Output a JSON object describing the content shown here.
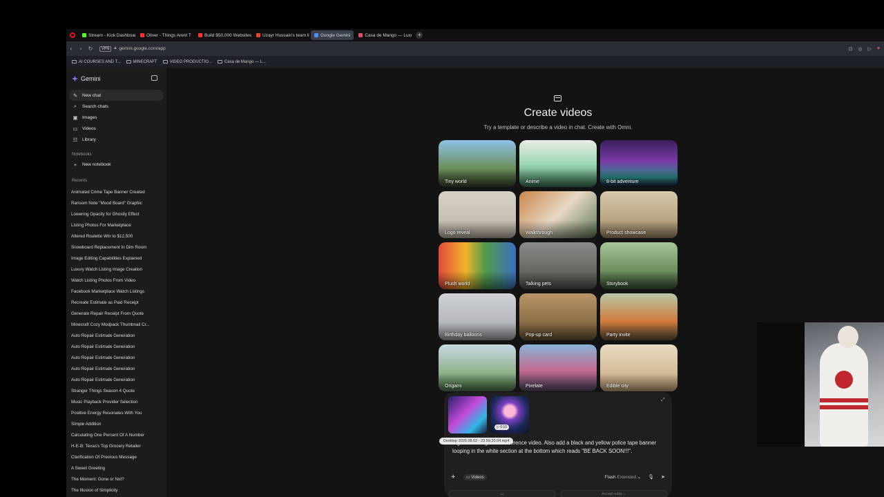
{
  "browser": {
    "tabs": [
      {
        "label": "Stream - Kick Dashboard",
        "color": "#53fc18"
      },
      {
        "label": "Oliver - Things Arent T",
        "color": "#ff2d2d"
      },
      {
        "label": "Build $50,000 Websites U",
        "color": "#ff2d2d"
      },
      {
        "label": "Uzayr Hussain's team libr",
        "color": "#ea4335"
      },
      {
        "label": "Google Gemini",
        "color": "#4c8df6",
        "active": true
      },
      {
        "label": "Casa de Mango — Luxury",
        "color": "#e34d6a"
      }
    ],
    "new_tab": "+",
    "vpn": "VPN",
    "url": "gemini.google.com/app",
    "bookmarks": [
      "AI COURSES AND T...",
      "MINECRAFT",
      "VIDEO PRODUCTIO...",
      "Casa de Mango — L..."
    ]
  },
  "sidebar": {
    "brand": "Gemini",
    "nav": [
      {
        "label": "New chat",
        "icon": "new-chat-icon",
        "glyph": "✎"
      },
      {
        "label": "Search chats",
        "icon": "search-icon",
        "glyph": "⌕"
      },
      {
        "label": "Images",
        "icon": "image-icon",
        "glyph": "▣"
      },
      {
        "label": "Videos",
        "icon": "video-icon",
        "glyph": "▭"
      },
      {
        "label": "Library",
        "icon": "library-icon",
        "glyph": "☷"
      }
    ],
    "notebooks_title": "Notebooks",
    "new_notebook": "New notebook",
    "recents_title": "Recents",
    "recents": [
      "Animated Crime Tape Banner Created",
      "Ransom Note \"Mood Board\" Graphic",
      "Lowering Opacity for Ghostly Effect",
      "Listing Photos For Marketplace",
      "Altered Roulette Win to $12,500",
      "Snowboard Replacement In Dim Room",
      "Image Editing Capabilities Explained",
      "Luxury Watch Listing Image Creation",
      "Watch Listing Photos From Video",
      "Facebook Marketplace Watch Listings",
      "Recreate Estimate as Paid Receipt",
      "Generate Repair Receipt From Quote",
      "Minecraft Cozy Modpack Thumbnail Cr...",
      "Auto Repair Estimate Generation",
      "Auto Repair Estimate Generation",
      "Auto Repair Estimate Generation",
      "Auto Repair Estimate Generation",
      "Auto Repair Estimate Generation",
      "Stranger Things Season 4 Quote",
      "Music Playback Provider Selection",
      "Positive Energy Resonates With You",
      "Simple Addition",
      "Calculating One Percent Of A Number",
      "H-E-B: Texas's Top Grocery Retailer",
      "Clarification Of Previous Message",
      "A Sweet Greeting",
      "The Moment: Gone or Not?",
      "The Illusion of Simplicity"
    ]
  },
  "main": {
    "heading": "Create videos",
    "subheading": "Try a template or describe a video in chat. Create with Omni.",
    "templates": [
      {
        "label": "Tiny world",
        "bg": "linear-gradient(180deg,#8fc0e8,#6b8f5a 60%,#3c4a2c)"
      },
      {
        "label": "Anime",
        "bg": "linear-gradient(180deg,#e9ede7,#9fd8b5 50%,#3b7a56)"
      },
      {
        "label": "8-bit adventure",
        "bg": "linear-gradient(180deg,#3a1f5c,#7a3aa6 45%,#2b8f8a 80%,#1c1c3c)"
      },
      {
        "label": "Logo reveal",
        "bg": "linear-gradient(180deg,#d8d1c6,#bfb6a8)"
      },
      {
        "label": "Walkthrough",
        "bg": "linear-gradient(135deg,#c9864a,#e8d8c4 50%,#5f7a5a)"
      },
      {
        "label": "Product showcase",
        "bg": "linear-gradient(180deg,#d7c9ac,#a58f6a)"
      },
      {
        "label": "Plush world",
        "bg": "linear-gradient(90deg,#e24a3a,#f0b42b 35%,#4f9c48 60%,#3b6fc2)"
      },
      {
        "label": "Talking pets",
        "bg": "linear-gradient(180deg,#8a8a88,#55524d)"
      },
      {
        "label": "Storybook",
        "bg": "linear-gradient(180deg,#a9c49a,#6e8f5f 60%,#3f5a3a)"
      },
      {
        "label": "Birthday balloons",
        "bg": "linear-gradient(180deg,#cfd2d6,#a6a9ae)"
      },
      {
        "label": "Pop-up card",
        "bg": "linear-gradient(180deg,#b89566,#6f5634)"
      },
      {
        "label": "Party invite",
        "bg": "linear-gradient(180deg,#b9c9a9,#d07a3a 60%,#6e5a3e)"
      },
      {
        "label": "Origami",
        "bg": "linear-gradient(180deg,#c9d9e4,#8fb38a 60%,#4f7a4c)"
      },
      {
        "label": "Pixelate",
        "bg": "linear-gradient(180deg,#8ab4d8,#c06a8e 55%,#5a4a6a)"
      },
      {
        "label": "Edible city",
        "bg": "linear-gradient(180deg,#e8dcc4,#c8a77a)"
      }
    ],
    "prompt": {
      "attachment_duration": "▷ 0:10",
      "tooltip": "Desktop 2026.08.02 - 23.59.20.04.mp4",
      "text": "...ge according to the reference video. Also add a black and yellow police tape banner looping in the white section at the bottom which reads \"BE BACK SOON!!!\".",
      "tool_chip": "Videos",
      "model": "Flash",
      "model_mode": "Extended",
      "bottom_buttons": [
        "▭",
        "Accept edits ⌄"
      ]
    }
  }
}
